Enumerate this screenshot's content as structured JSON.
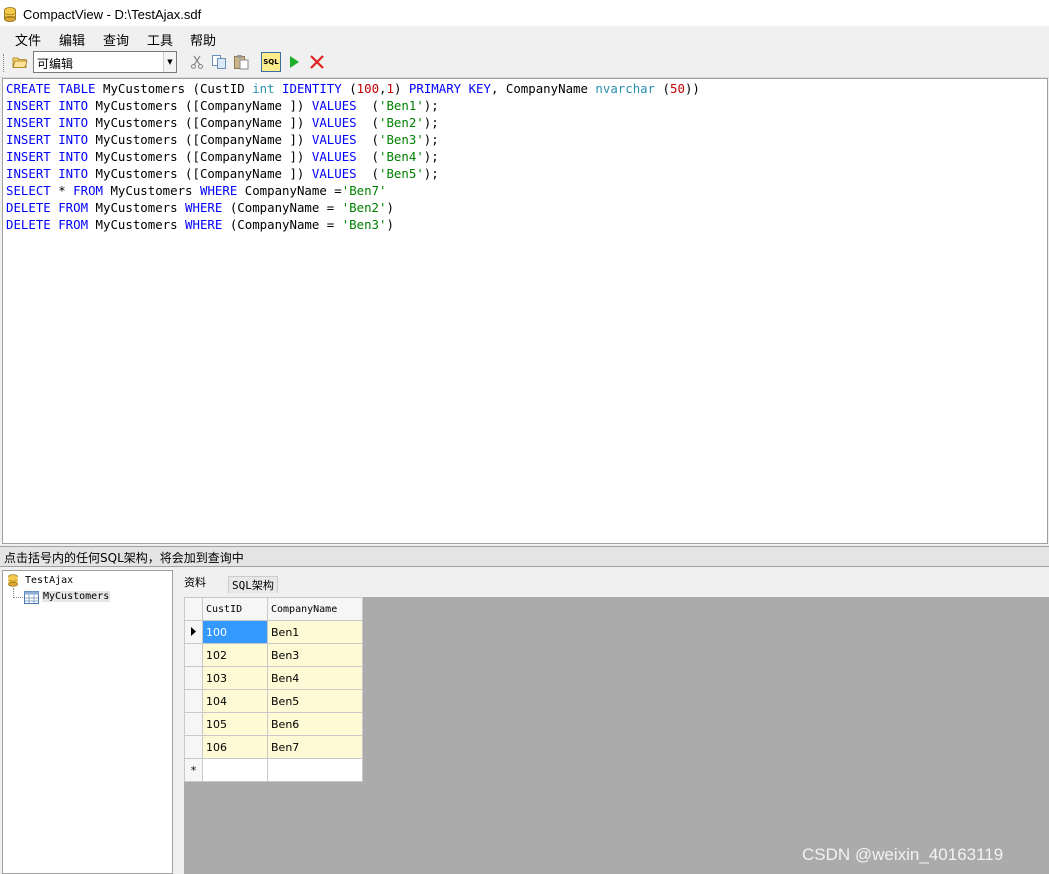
{
  "window": {
    "title": "CompactView - D:\\TestAjax.sdf"
  },
  "menu": [
    "文件",
    "编辑",
    "查询",
    "工具",
    "帮助"
  ],
  "toolbar": {
    "mode_value": "可编辑",
    "sql_label": "SQL"
  },
  "editor": {
    "lines": [
      [
        [
          "CREATE TABLE",
          "kw"
        ],
        [
          " MyCustomers (CustID ",
          ""
        ],
        [
          "int",
          "ty"
        ],
        [
          " ",
          ""
        ],
        [
          "IDENTITY",
          "kw"
        ],
        [
          " (",
          ""
        ],
        [
          "100",
          "num"
        ],
        [
          ",",
          ""
        ],
        [
          "1",
          "num"
        ],
        [
          ") ",
          ""
        ],
        [
          "PRIMARY KEY",
          "kw"
        ],
        [
          ", CompanyName ",
          ""
        ],
        [
          "nvarchar",
          "ty"
        ],
        [
          " (",
          ""
        ],
        [
          "50",
          "num"
        ],
        [
          "))",
          ""
        ]
      ],
      [
        [
          "INSERT INTO",
          "kw"
        ],
        [
          " MyCustomers ([CompanyName ]) ",
          ""
        ],
        [
          "VALUES",
          "kw"
        ],
        [
          "  (",
          ""
        ],
        [
          "'Ben1'",
          "str"
        ],
        [
          ");",
          ""
        ]
      ],
      [
        [
          "INSERT INTO",
          "kw"
        ],
        [
          " MyCustomers ([CompanyName ]) ",
          ""
        ],
        [
          "VALUES",
          "kw"
        ],
        [
          "  (",
          ""
        ],
        [
          "'Ben2'",
          "str"
        ],
        [
          ");",
          ""
        ]
      ],
      [
        [
          "INSERT INTO",
          "kw"
        ],
        [
          " MyCustomers ([CompanyName ]) ",
          ""
        ],
        [
          "VALUES",
          "kw"
        ],
        [
          "  (",
          ""
        ],
        [
          "'Ben3'",
          "str"
        ],
        [
          ");",
          ""
        ]
      ],
      [
        [
          "INSERT INTO",
          "kw"
        ],
        [
          " MyCustomers ([CompanyName ]) ",
          ""
        ],
        [
          "VALUES",
          "kw"
        ],
        [
          "  (",
          ""
        ],
        [
          "'Ben4'",
          "str"
        ],
        [
          ");",
          ""
        ]
      ],
      [
        [
          "INSERT INTO",
          "kw"
        ],
        [
          " MyCustomers ([CompanyName ]) ",
          ""
        ],
        [
          "VALUES",
          "kw"
        ],
        [
          "  (",
          ""
        ],
        [
          "'Ben5'",
          "str"
        ],
        [
          ");",
          ""
        ]
      ],
      [
        [
          "SELECT",
          "kw"
        ],
        [
          " * ",
          ""
        ],
        [
          "FROM",
          "kw"
        ],
        [
          " MyCustomers ",
          ""
        ],
        [
          "WHERE",
          "kw"
        ],
        [
          " CompanyName =",
          ""
        ],
        [
          "'Ben7'",
          "str"
        ]
      ],
      [
        [
          "DELETE FROM",
          "kw"
        ],
        [
          " MyCustomers ",
          ""
        ],
        [
          "WHERE",
          "kw"
        ],
        [
          " (CompanyName = ",
          ""
        ],
        [
          "'Ben2'",
          "str"
        ],
        [
          ")",
          ""
        ]
      ],
      [
        [
          "DELETE FROM",
          "kw"
        ],
        [
          " MyCustomers ",
          ""
        ],
        [
          "WHERE",
          "kw"
        ],
        [
          " (CompanyName = ",
          ""
        ],
        [
          "'Ben3'",
          "str"
        ],
        [
          ")",
          ""
        ]
      ]
    ]
  },
  "status_text": "点击括号内的任何SQL架构，将会加到查询中",
  "tree": {
    "database": "TestAjax",
    "table": "MyCustomers"
  },
  "tabs": {
    "data": "资料",
    "schema": "SQL架构"
  },
  "grid": {
    "columns": [
      "CustID",
      "CompanyName"
    ],
    "rows": [
      [
        "100",
        "Ben1"
      ],
      [
        "102",
        "Ben3"
      ],
      [
        "103",
        "Ben4"
      ],
      [
        "104",
        "Ben5"
      ],
      [
        "105",
        "Ben6"
      ],
      [
        "106",
        "Ben7"
      ]
    ],
    "new_row_marker": "*"
  },
  "watermark": "CSDN @weixin_40163119"
}
